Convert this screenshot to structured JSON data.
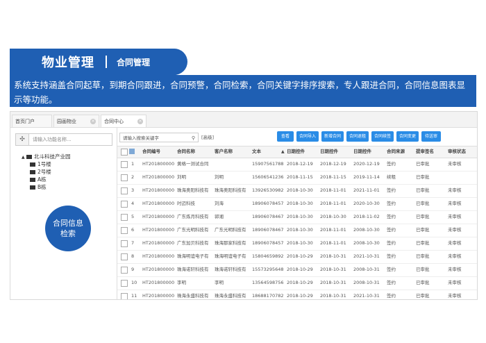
{
  "banner": {
    "title": "物业管理",
    "subtitle": "合同管理"
  },
  "description": "系统支持涵盖合同起草，到期合同跟进，合同预警，合同检索，合同关键字排序搜索，专人跟进合同，合同信息图表显示等功能。",
  "tabs": [
    {
      "label": "首页门户"
    },
    {
      "label": "园画物业"
    },
    {
      "label": "合同中心"
    }
  ],
  "left": {
    "search_placeholder": "请输入功能名称...",
    "tree": [
      {
        "label": "北斗科技产业园",
        "level": 0
      },
      {
        "label": "1号楼",
        "level": 1
      },
      {
        "label": "2号楼",
        "level": 1
      },
      {
        "label": "A栋",
        "level": 1
      },
      {
        "label": "B栋",
        "level": 1
      }
    ],
    "callout": "合同信息检索"
  },
  "toolbar": {
    "search_placeholder": "请输入搜索关键字",
    "search_icon": "magnifier-icon",
    "advanced_label": "[高级]",
    "buttons": [
      "查看",
      "合同导入",
      "新增合同",
      "合同退租",
      "合同续签",
      "合同变更",
      "待送审"
    ]
  },
  "table": {
    "columns": [
      "",
      "合同编号",
      "合同名称",
      "客户名称",
      "文本",
      "日期控件",
      "日期控件",
      "日期控件",
      "合同来源",
      "提审签名",
      "审核状态"
    ],
    "rows": [
      [
        "1",
        "HT201800000",
        "黄格一测试合同",
        "",
        "15907561788",
        "2018-12-19",
        "2018-12-19",
        "2020-12-19",
        "签约",
        "已审批",
        "未审核"
      ],
      [
        "2",
        "HT201800000",
        "刘明",
        "刘明",
        "15606541236",
        "2018-11-15",
        "2018-11-15",
        "2019-11-14",
        "续租",
        "已审批",
        ""
      ],
      [
        "3",
        "HT201800000",
        "珠海奥阳科技有",
        "珠海奥阳科技有",
        "13926530982",
        "2018-10-30",
        "2018-11-01",
        "2021-11-01",
        "签约",
        "已审批",
        "未审核"
      ],
      [
        "4",
        "HT201800000",
        "时迈科技",
        "刘海",
        "18906078457",
        "2018-10-30",
        "2018-11-01",
        "2020-10-30",
        "签约",
        "已审批",
        "未审核"
      ],
      [
        "5",
        "HT201800000",
        "广东炼月科技有",
        "郭湘",
        "18906078467",
        "2018-10-30",
        "2018-10-30",
        "2018-11-02",
        "签约",
        "已审批",
        "未审核"
      ],
      [
        "6",
        "HT201800000",
        "广东光明科技有",
        "广东光明科技有",
        "18906078467",
        "2018-10-30",
        "2018-11-01",
        "2008-10-30",
        "签约",
        "已审批",
        "未审核"
      ],
      [
        "7",
        "HT201800000",
        "广东加贝科技有",
        "珠海那家科技有",
        "18906078457",
        "2018-10-30",
        "2018-11-01",
        "2008-10-30",
        "签约",
        "已审批",
        "未审核"
      ],
      [
        "8",
        "HT201800000",
        "珠海明谊电子有",
        "珠海明谊电子有",
        "15804659892",
        "2018-10-29",
        "2018-10-31",
        "2021-10-31",
        "签约",
        "已审批",
        "未审核"
      ],
      [
        "9",
        "HT201800000",
        "珠海诺轩科技有",
        "珠海诺轩科技有",
        "15573295648",
        "2018-10-29",
        "2018-10-31",
        "2008-10-31",
        "签约",
        "已审批",
        "未审核"
      ],
      [
        "10",
        "HT201800000",
        "李明",
        "李明",
        "13564598756",
        "2018-10-29",
        "2018-10-31",
        "2008-10-31",
        "签约",
        "已审批",
        "未审核"
      ],
      [
        "11",
        "HT201800000",
        "珠海永盛科技有",
        "珠海永盛科技有",
        "18688170782",
        "2018-10-29",
        "2018-10-31",
        "2021-10-31",
        "签约",
        "已审批",
        "未审核"
      ]
    ]
  }
}
